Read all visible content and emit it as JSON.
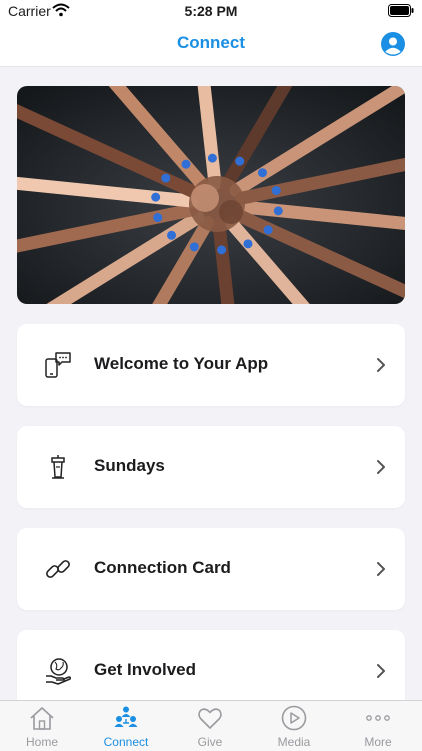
{
  "status_bar": {
    "carrier": "Carrier",
    "time": "5:28 PM",
    "wifi_icon": "wifi-icon",
    "battery_icon": "battery-icon"
  },
  "nav": {
    "title": "Connect",
    "profile_icon": "profile-icon"
  },
  "hero": {
    "image_icon": "stacked-hands-photo"
  },
  "cards": [
    {
      "label": "Welcome to Your App",
      "icon": "phone-chat-icon"
    },
    {
      "label": "Sundays",
      "icon": "podium-icon"
    },
    {
      "label": "Connection Card",
      "icon": "link-icon"
    },
    {
      "label": "Get Involved",
      "icon": "globe-hand-icon"
    }
  ],
  "tabs": [
    {
      "label": "Home",
      "icon": "home-icon",
      "active": false
    },
    {
      "label": "Connect",
      "icon": "people-icon",
      "active": true
    },
    {
      "label": "Give",
      "icon": "heart-icon",
      "active": false
    },
    {
      "label": "Media",
      "icon": "play-icon",
      "active": false
    },
    {
      "label": "More",
      "icon": "more-dots-icon",
      "active": false
    }
  ],
  "colors": {
    "accent": "#1a8fe3",
    "background": "#f2f2f7",
    "card": "#ffffff",
    "tab_inactive": "#9a9a9f"
  }
}
